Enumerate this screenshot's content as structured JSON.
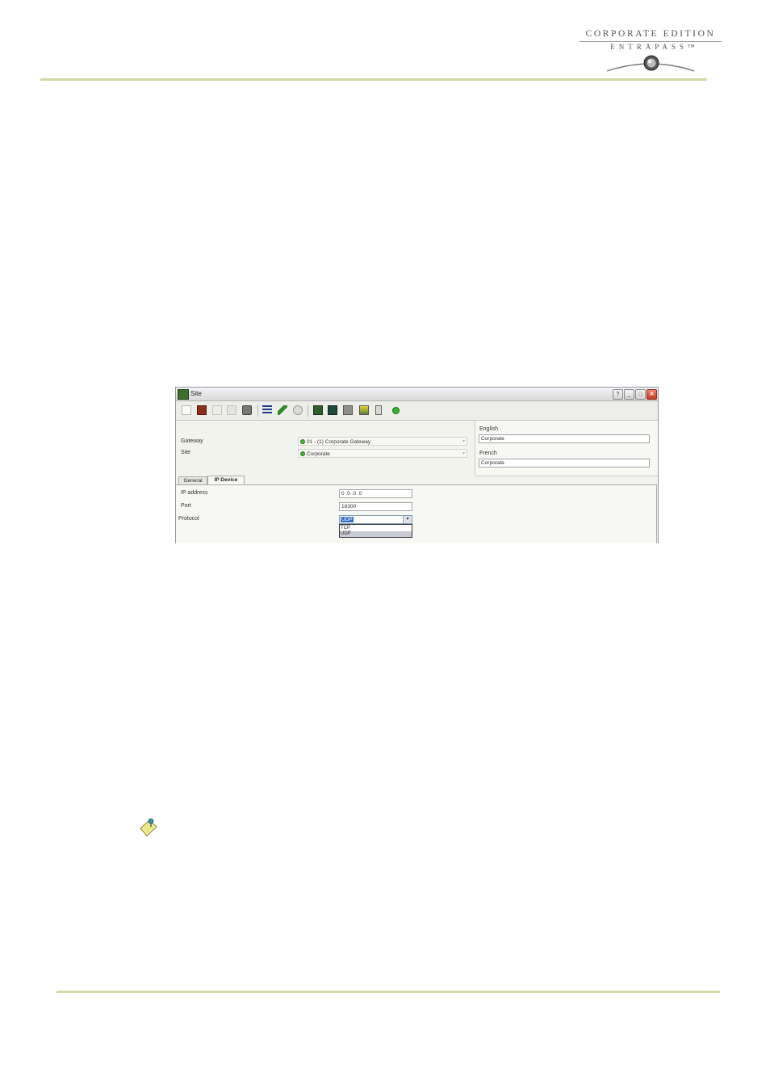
{
  "header": {
    "brand_line1": "CORPORATE EDITION",
    "brand_line2": "ENTRAPASS™"
  },
  "window": {
    "title": "Site",
    "buttons": {
      "help": "?",
      "minimize": "_",
      "maximize": "□",
      "close": "✕"
    },
    "toolbar_icons": [
      "new-icon",
      "save-icon",
      "copy-icon",
      "delete-icon",
      "print-icon",
      "list-icon",
      "link-icon",
      "search-icon",
      "door-icon",
      "controller-icon",
      "relay-icon",
      "input-icon",
      "output-icon",
      "status-dot-icon"
    ]
  },
  "form": {
    "gateway_label": "Gateway",
    "gateway_value": "01 - (1)  Corporate Gateway",
    "site_label": "Site",
    "site_value": "Corporate",
    "english_label": "English",
    "english_value": "Corporate",
    "french_label": "French",
    "french_value": "Corporate"
  },
  "tabs": [
    {
      "label": "General",
      "active": false
    },
    {
      "label": "IP Device",
      "active": true
    }
  ],
  "ip_device": {
    "ip_label": "IP address",
    "ip_value": "0 .0 .0 .0",
    "port_label": "Port",
    "port_value": "18300",
    "protocol_label": "Protocol",
    "protocol_selected": "UDP",
    "protocol_options": [
      "TCP",
      "UDP"
    ]
  },
  "colors": {
    "rule": "#d6d8a8",
    "status_green": "#43b032",
    "close_red": "#c43b1f"
  },
  "note_icon": "note-pad-icon"
}
